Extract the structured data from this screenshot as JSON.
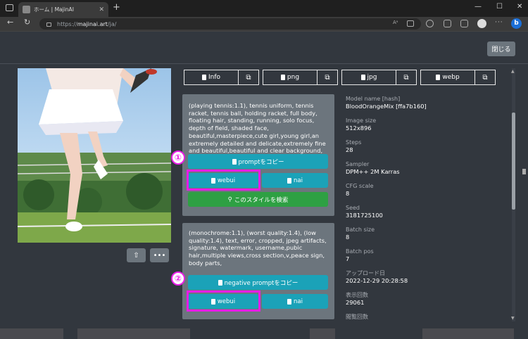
{
  "browser": {
    "tab_title": "ホーム | MajinAI",
    "tab_close": "✕",
    "new_tab": "+",
    "url_prefix": "https://",
    "url_host": "majinai.art",
    "url_path": "/ja/",
    "back": "←",
    "reload": "↻",
    "minimize": "—",
    "maximize": "☐",
    "close": "✕",
    "more": "···",
    "bing": "b",
    "read_aloud": "Aᵃ"
  },
  "header": {
    "close_label": "閉じる"
  },
  "image_actions": {
    "share": "⇧",
    "more": "•••"
  },
  "formats": [
    {
      "label": "Info",
      "ext": "⧉"
    },
    {
      "label": "png",
      "ext": "⧉"
    },
    {
      "label": "jpg",
      "ext": "⧉"
    },
    {
      "label": "webp",
      "ext": "⧉"
    }
  ],
  "prompt": {
    "text": "(playing tennis:1.1), tennis uniform, tennis racket, tennis ball, holding racket, full body, floating hair, standing, running, solo focus, depth of field, shaded face, beautiful,masterpiece,cute girl,young girl,an extremely detailed and delicate,extremely fine and beautiful,beautiful and clear background,",
    "copy_label": "promptをコピー",
    "webui_label": "webui",
    "nai_label": "nai",
    "search_label": "このスタイルを検索",
    "marker": "①"
  },
  "negative": {
    "text": "(monochrome:1.1), (worst quality:1.4), (low quality:1.4), text, error, cropped, jpeg artifacts, signature, watermark, username,pubic hair,multiple views,cross section,v,peace sign, body parts,",
    "copy_label": "negative promptをコピー",
    "webui_label": "webui",
    "nai_label": "nai",
    "marker": "②"
  },
  "meta": [
    {
      "key": "Model name [hash]",
      "value": "BloodOrangeMix [ffa7b160]"
    },
    {
      "key": "Image size",
      "value": "512x896"
    },
    {
      "key": "Steps",
      "value": "28"
    },
    {
      "key": "Sampler",
      "value": "DPM++ 2M Karras"
    },
    {
      "key": "CFG scale",
      "value": "8"
    },
    {
      "key": "Seed",
      "value": "3181725100"
    },
    {
      "key": "Batch size",
      "value": "8"
    },
    {
      "key": "Batch pos",
      "value": "7"
    },
    {
      "key": "アップロード日",
      "value": "2022-12-29 20:28:58"
    },
    {
      "key": "表示回数",
      "value": "29061"
    },
    {
      "key": "閲覧回数",
      "value": ""
    }
  ],
  "colors": {
    "teal": "#1ba2b8",
    "green": "#2ea043",
    "highlight": "#e81de6",
    "card": "#6c757d",
    "page_bg": "#32373e"
  }
}
